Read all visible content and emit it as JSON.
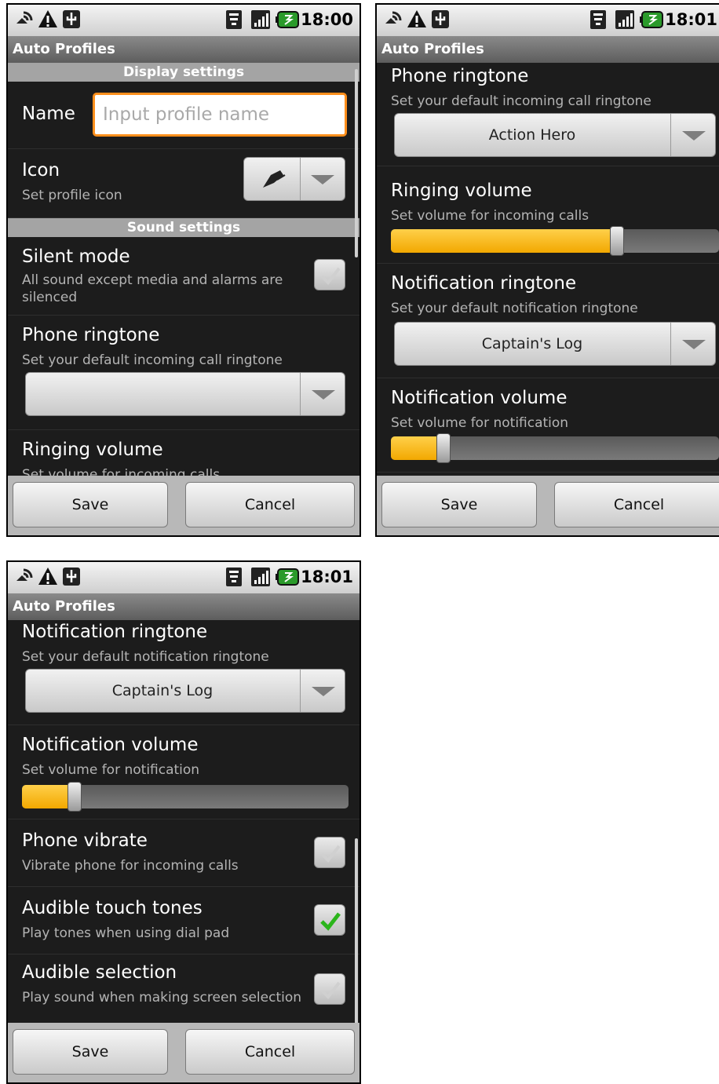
{
  "status": {
    "time1": "18:00",
    "time2": "18:01",
    "time3": "18:01"
  },
  "app_title": "Auto Profiles",
  "screen1": {
    "display_header": "Display settings",
    "name_label": "Name",
    "name_placeholder": "Input profile name",
    "icon_title": "Icon",
    "icon_sub": "Set profile icon",
    "sound_header": "Sound settings",
    "silent_title": "Silent mode",
    "silent_sub": "All sound except media and alarms are silenced",
    "ringtone_title": "Phone ringtone",
    "ringtone_sub": "Set your default incoming call ringtone",
    "ringtone_value": "",
    "ringing_title": "Ringing volume",
    "ringing_sub": "Set volume for incoming calls"
  },
  "screen2": {
    "ringtone_title": "Phone ringtone",
    "ringtone_sub": "Set your default incoming call ringtone",
    "ringtone_value": "Action Hero",
    "ringing_title": "Ringing volume",
    "ringing_sub": "Set volume for incoming calls",
    "ringing_level": 0.69,
    "notif_title": "Notification ringtone",
    "notif_sub": "Set your default notification ringtone",
    "notif_value": "Captain's Log",
    "notifvol_title": "Notification volume",
    "notifvol_sub": "Set volume for notification",
    "notifvol_level": 0.16
  },
  "screen3": {
    "notif_title": "Notification ringtone",
    "notif_sub": "Set your default notification ringtone",
    "notif_value": "Captain's Log",
    "notifvol_title": "Notification volume",
    "notifvol_sub": "Set volume for notification",
    "notifvol_level": 0.16,
    "vibrate_title": "Phone vibrate",
    "vibrate_sub": "Vibrate phone for incoming calls",
    "vibrate_checked": false,
    "touch_title": "Audible touch tones",
    "touch_sub": "Play tones when using dial pad",
    "touch_checked": true,
    "selection_title": "Audible selection",
    "selection_sub": "Play sound when making screen selection",
    "selection_checked": false
  },
  "buttons": {
    "save": "Save",
    "cancel": "Cancel"
  },
  "colors": {
    "accent": "#f2a800",
    "focus": "#ff8f1c",
    "check_green": "#2bb51b"
  },
  "icons": [
    "speaker-icon",
    "warning-icon",
    "usb-icon",
    "wifi-icon",
    "signal-icon",
    "battery-icon",
    "profile-icon"
  ]
}
